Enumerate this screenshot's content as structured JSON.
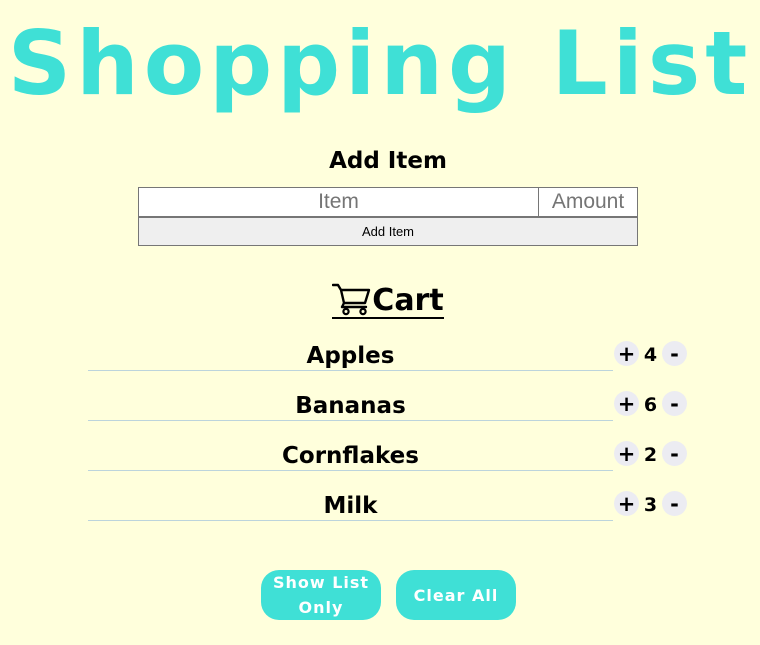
{
  "app": {
    "title": "Shopping List",
    "accent_color": "#3fe0d6",
    "background_color": "#ffffdc"
  },
  "add_form": {
    "heading": "Add Item",
    "item_placeholder": "Item",
    "item_value": "",
    "amount_placeholder": "Amount",
    "amount_value": "",
    "submit_label": "Add Item"
  },
  "cart": {
    "heading": "Cart",
    "icon": "shopping-cart-icon",
    "items": [
      {
        "name": "Apples",
        "quantity": "4",
        "plus_label": "+",
        "minus_label": "-"
      },
      {
        "name": "Bananas",
        "quantity": "6",
        "plus_label": "+",
        "minus_label": "-"
      },
      {
        "name": "Cornflakes",
        "quantity": "2",
        "plus_label": "+",
        "minus_label": "-"
      },
      {
        "name": "Milk",
        "quantity": "3",
        "plus_label": "+",
        "minus_label": "-"
      }
    ]
  },
  "actions": {
    "show_list_label": "Show List Only",
    "clear_all_label": "Clear All"
  }
}
